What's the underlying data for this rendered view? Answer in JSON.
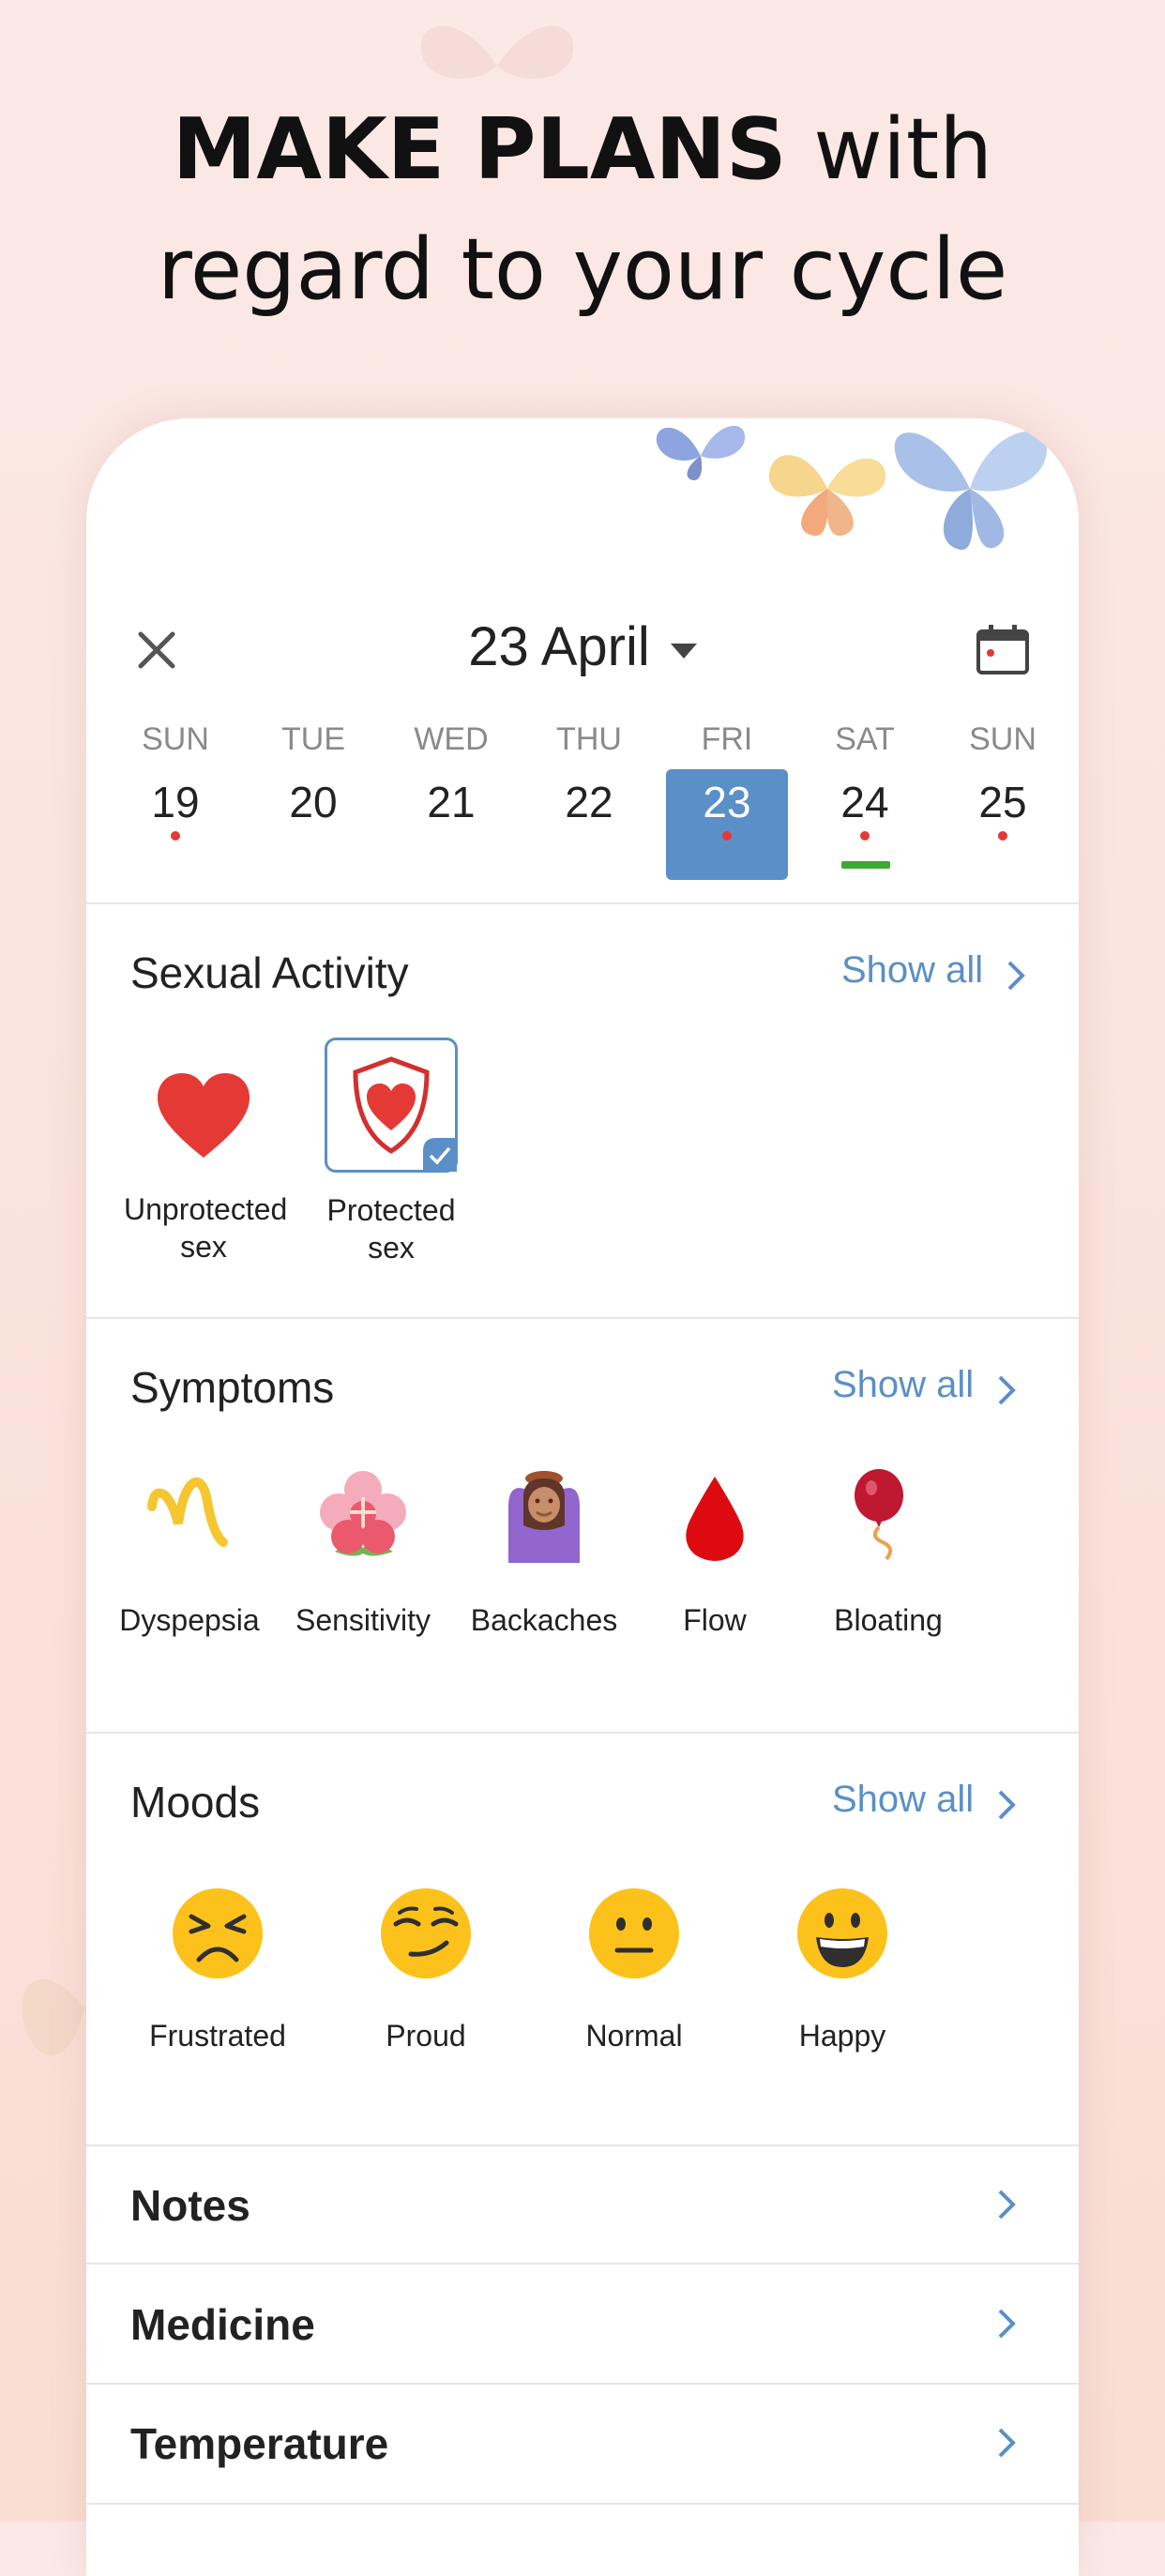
{
  "headline": {
    "bold": "MAKE PLANS",
    "rest1": " with",
    "line2": "regard to your cycle"
  },
  "header": {
    "month_label": "23 April"
  },
  "week": [
    {
      "name": "SUN",
      "date": "19",
      "dot": true
    },
    {
      "name": "TUE",
      "date": "20",
      "dot": false
    },
    {
      "name": "WED",
      "date": "21",
      "dot": false
    },
    {
      "name": "THU",
      "date": "22",
      "dot": false
    },
    {
      "name": "FRI",
      "date": "23",
      "dot": true,
      "selected": true
    },
    {
      "name": "SAT",
      "date": "24",
      "dot": true,
      "underline": true
    },
    {
      "name": "SUN",
      "date": "25",
      "dot": true
    }
  ],
  "sexual_activity": {
    "title": "Sexual Activity",
    "show_all": "Show all",
    "items": [
      {
        "line1": "Unprotected",
        "line2": "sex",
        "icon": "heart-icon"
      },
      {
        "line1": "Protected",
        "line2": "sex",
        "icon": "shield-heart-icon",
        "selected": true
      }
    ]
  },
  "symptoms": {
    "title": "Symptoms",
    "show_all": "Show all",
    "items": [
      {
        "label": "Dyspepsia",
        "icon": "squiggle-icon"
      },
      {
        "label": "Sensitivity",
        "icon": "flower-icon"
      },
      {
        "label": "Backaches",
        "icon": "person-icon"
      },
      {
        "label": "Flow",
        "icon": "drop-icon"
      },
      {
        "label": "Bloating",
        "icon": "balloon-icon"
      }
    ]
  },
  "moods": {
    "title": "Moods",
    "show_all": "Show all",
    "items": [
      {
        "label": "Frustrated",
        "icon": "frustrated-face-icon"
      },
      {
        "label": "Proud",
        "icon": "smirk-face-icon"
      },
      {
        "label": "Normal",
        "icon": "neutral-face-icon"
      },
      {
        "label": "Happy",
        "icon": "happy-face-icon"
      }
    ]
  },
  "rows": {
    "notes": "Notes",
    "medicine": "Medicine",
    "temperature": "Temperature"
  },
  "colors": {
    "accent": "#5b8fc7",
    "red": "#e53935",
    "green": "#3aaa35",
    "emoji_yellow": "#fcc21b"
  }
}
